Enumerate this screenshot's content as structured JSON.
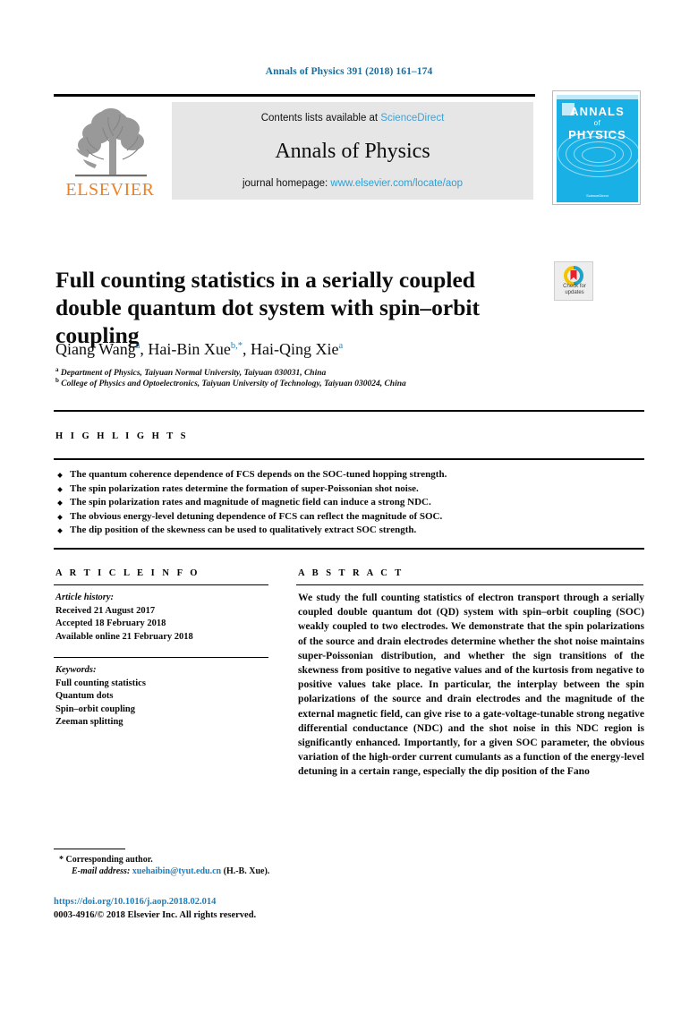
{
  "running_head": "Annals of Physics 391 (2018) 161–174",
  "masthead": {
    "contents_prefix": "Contents lists available at ",
    "sciencedirect": "ScienceDirect",
    "journal_name": "Annals of Physics",
    "homepage_prefix": "journal homepage: ",
    "homepage_url": "www.elsevier.com/locate/aop",
    "publisher_logo_text": "ELSEVIER",
    "publisher_logo_icon": "elsevier-tree-icon",
    "accent_blue": "#3ba3d8",
    "logo_orange": "#F08122",
    "header_blue": "#1a6c9c"
  },
  "cover": {
    "line1": "ANNALS",
    "line2": "of",
    "line3": "PHYSICS",
    "footer": "ScienceDirect",
    "background": "#19b0e6"
  },
  "crossmark": {
    "line1": "Check for",
    "line2": "updates",
    "icon": "crossmark-check-for-updates-icon"
  },
  "article": {
    "title": "Full counting statistics in a serially coupled double quantum dot system with spin–orbit coupling",
    "authors": [
      {
        "name": "Qiang Wang",
        "sup": "a",
        "star": false,
        "sep": ", "
      },
      {
        "name": "Hai-Bin Xue",
        "sup": "b",
        "star": true,
        "sep": ", "
      },
      {
        "name": "Hai-Qing Xie",
        "sup": "a",
        "star": false,
        "sep": ""
      }
    ],
    "affiliations": [
      {
        "mark": "a",
        "text": "Department of Physics, Taiyuan Normal University, Taiyuan 030031, China"
      },
      {
        "mark": "b",
        "text": "College of Physics and Optoelectronics, Taiyuan University of Technology, Taiyuan 030024, China"
      }
    ]
  },
  "highlights": {
    "heading": "H I G H L I G H T S",
    "items": [
      "The quantum coherence dependence of FCS depends on the SOC-tuned hopping strength.",
      "The spin polarization rates determine the formation of super-Poissonian shot noise.",
      "The spin polarization rates and magnitude of magnetic field can induce a strong NDC.",
      "The obvious energy-level detuning dependence of FCS can reflect the magnitude of SOC.",
      "The dip position of the skewness can be used to qualitatively extract SOC strength."
    ]
  },
  "article_info": {
    "heading": "A R T I C L E    I N F O",
    "history_label": "Article history:",
    "history": [
      "Received 21 August 2017",
      "Accepted 18 February 2018",
      "Available online 21 February 2018"
    ],
    "keywords_label": "Keywords:",
    "keywords": [
      "Full counting statistics",
      "Quantum dots",
      "Spin–orbit coupling",
      "Zeeman splitting"
    ]
  },
  "abstract": {
    "heading": "A B S T R A C T",
    "text": "We study the full counting statistics of electron transport through a serially coupled double quantum dot (QD) system with spin–orbit coupling (SOC) weakly coupled to two electrodes. We demonstrate that the spin polarizations of the source and drain electrodes determine whether the shot noise maintains super-Poissonian distribution, and whether the sign transitions of the skewness from positive to negative values and of the kurtosis from negative to positive values take place. In particular, the interplay between the spin polarizations of the source and drain electrodes and the magnitude of the external magnetic field, can give rise to a gate-voltage-tunable strong negative differential conductance (NDC) and the shot noise in this NDC region is significantly enhanced. Importantly, for a given SOC parameter, the obvious variation of the high-order current cumulants as a function of the energy-level detuning in a certain range, especially the dip position of the Fano"
  },
  "footer": {
    "corresponding_marker": "*",
    "corresponding_text": "Corresponding author.",
    "email_label": "E-mail address:",
    "email": "xuehaibin@tyut.edu.cn",
    "email_owner": "(H.-B. Xue).",
    "doi": "https://doi.org/10.1016/j.aop.2018.02.014",
    "copyright": "0003-4916/© 2018 Elsevier Inc. All rights reserved.",
    "link_blue": "#1a7fc1"
  }
}
